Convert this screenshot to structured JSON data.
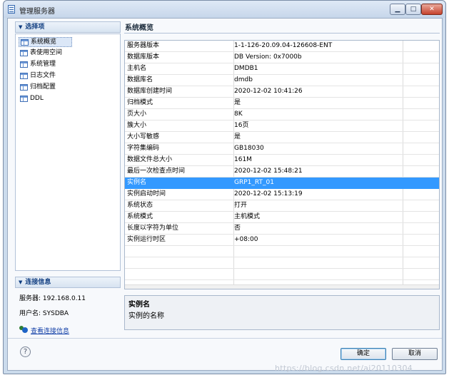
{
  "window": {
    "title": "管理服务器"
  },
  "left": {
    "select_header": "选择项",
    "nav_items": [
      {
        "label": "系统概览",
        "selected": true
      },
      {
        "label": "表使用空间",
        "selected": false
      },
      {
        "label": "系统管理",
        "selected": false
      },
      {
        "label": "日志文件",
        "selected": false
      },
      {
        "label": "归档配置",
        "selected": false
      },
      {
        "label": "DDL",
        "selected": false
      }
    ],
    "conn_header": "连接信息",
    "server": "服务器: 192.168.0.11",
    "user": "用户名: SYSDBA",
    "view_link": "查看连接信息"
  },
  "main": {
    "title": "系统概览",
    "rows": [
      {
        "k": "服务器版本",
        "v": "1-1-126-20.09.04-126608-ENT"
      },
      {
        "k": "数据库版本",
        "v": "DB Version: 0x7000b"
      },
      {
        "k": "主机名",
        "v": "DMDB1"
      },
      {
        "k": "数据库名",
        "v": "dmdb"
      },
      {
        "k": "数据库创建时间",
        "v": "2020-12-02 10:41:26"
      },
      {
        "k": "归档模式",
        "v": "是"
      },
      {
        "k": "页大小",
        "v": "8K"
      },
      {
        "k": "簇大小",
        "v": "16页"
      },
      {
        "k": "大小写敏感",
        "v": "是"
      },
      {
        "k": "字符集编码",
        "v": "GB18030"
      },
      {
        "k": "数据文件总大小",
        "v": "161M"
      },
      {
        "k": "最后一次检查点时间",
        "v": "2020-12-02 15:48:21"
      },
      {
        "k": "实例名",
        "v": "GRP1_RT_01",
        "selected": true
      },
      {
        "k": "实例启动时间",
        "v": "2020-12-02 15:13:19"
      },
      {
        "k": "系统状态",
        "v": "打开"
      },
      {
        "k": "系统模式",
        "v": "主机模式"
      },
      {
        "k": "长度以字符为单位",
        "v": "否"
      },
      {
        "k": "实例运行时区",
        "v": "+08:00"
      }
    ],
    "desc_title": "实例名",
    "desc_text": "实例的名称"
  },
  "footer": {
    "help": "?",
    "ok": "确定",
    "cancel": "取消"
  },
  "watermark": "https://blog.csdn.net/ai20110304",
  "colors": {
    "selection": "#3399ff",
    "link": "#1441a8"
  }
}
